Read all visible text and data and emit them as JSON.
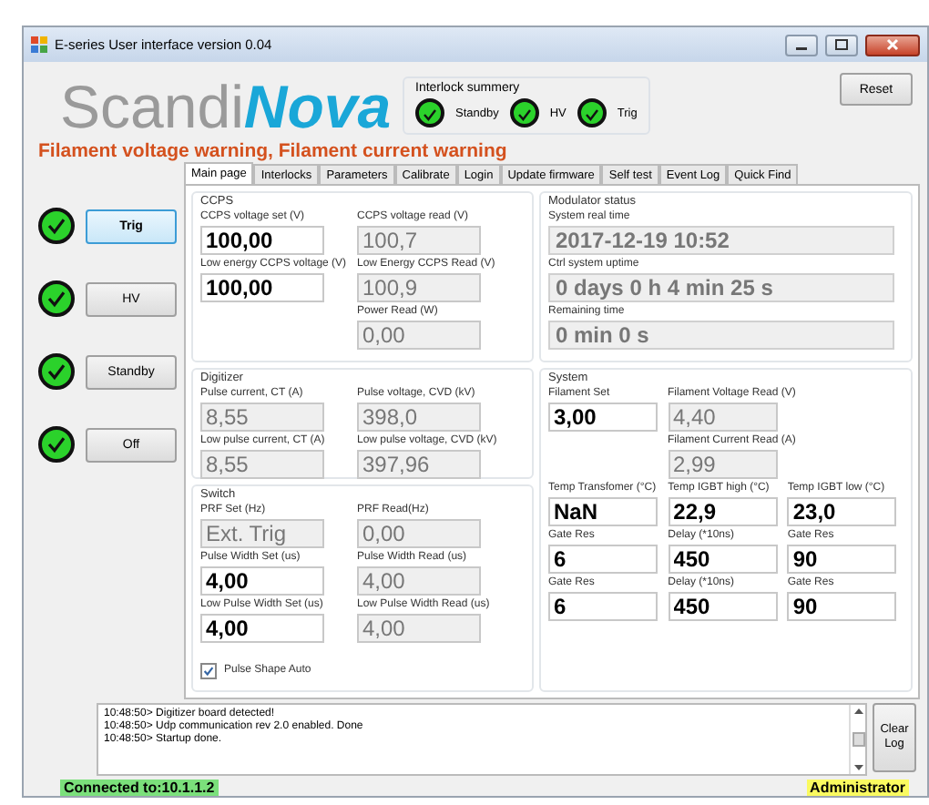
{
  "window": {
    "title": "E-series User interface version 0.04"
  },
  "logo": "Scandi**Nova**",
  "warning": "Filament voltage warning, Filament current warning",
  "interlock_summary": {
    "title": "Interlock summery",
    "items": [
      {
        "label": "Standby",
        "on": true
      },
      {
        "label": "HV",
        "on": true
      },
      {
        "label": "Trig",
        "on": true
      }
    ]
  },
  "reset_button": "Reset",
  "mode_buttons": [
    {
      "label": "Trig",
      "on": true,
      "selected": true
    },
    {
      "label": "HV",
      "on": true,
      "selected": false
    },
    {
      "label": "Standby",
      "on": true,
      "selected": false
    },
    {
      "label": "Off",
      "on": true,
      "selected": false
    }
  ],
  "tabs": [
    {
      "label": "Main page",
      "selected": true
    },
    {
      "label": "Interlocks",
      "selected": false
    },
    {
      "label": "Parameters",
      "selected": false
    },
    {
      "label": "Calibrate",
      "selected": false
    },
    {
      "label": "Login",
      "selected": false
    },
    {
      "label": "Update firmware",
      "selected": false
    },
    {
      "label": "Self test",
      "selected": false
    },
    {
      "label": "Event Log",
      "selected": false
    },
    {
      "label": "Quick Find",
      "selected": false
    }
  ],
  "ccps": {
    "title": "CCPS",
    "rows": [
      {
        "left": {
          "label": "CCPS voltage set (V)",
          "value": "100,00",
          "kind": "input"
        },
        "right": {
          "label": "CCPS voltage read (V)",
          "value": "100,7",
          "kind": "readout"
        }
      },
      {
        "left": {
          "label": "Low energy CCPS voltage (V)",
          "value": "100,00",
          "kind": "input"
        },
        "right": {
          "label": "Low Energy CCPS Read (V)",
          "value": "100,9",
          "kind": "readout"
        }
      },
      {
        "right": {
          "label": "Power Read (W)",
          "value": "0,00",
          "kind": "readout"
        }
      }
    ]
  },
  "digitizer": {
    "title": "Digitizer",
    "rows": [
      {
        "left": {
          "label": "Pulse current, CT (A)",
          "value": "8,55",
          "kind": "readout"
        },
        "right": {
          "label": "Pulse voltage, CVD (kV)",
          "value": "398,0",
          "kind": "readout"
        }
      },
      {
        "left": {
          "label": "Low pulse current, CT (A)",
          "value": "8,55",
          "kind": "readout"
        },
        "right": {
          "label": "Low pulse voltage, CVD (kV)",
          "value": "397,96",
          "kind": "readout"
        }
      }
    ]
  },
  "switch": {
    "title": "Switch",
    "rows": [
      {
        "left": {
          "label": "PRF Set (Hz)",
          "value": "Ext. Trig",
          "kind": "readout"
        },
        "right": {
          "label": "PRF Read(Hz)",
          "value": "0,00",
          "kind": "readout"
        }
      },
      {
        "left": {
          "label": "Pulse Width Set (us)",
          "value": "4,00",
          "kind": "input"
        },
        "right": {
          "label": "Pulse Width Read (us)",
          "value": "4,00",
          "kind": "readout"
        }
      },
      {
        "left": {
          "label": "Low Pulse Width Set (us)",
          "value": "4,00",
          "kind": "input"
        },
        "right": {
          "label": "Low Pulse Width Read (us)",
          "value": "4,00",
          "kind": "readout"
        }
      }
    ],
    "checkbox": {
      "label": "Pulse Shape Auto",
      "checked": true
    }
  },
  "modulator_status": {
    "title": "Modulator status",
    "fields": [
      {
        "label": "System real time",
        "value": "2017-12-19 10:52"
      },
      {
        "label": "Ctrl system uptime",
        "value": "0 days 0 h 4 min 25 s"
      },
      {
        "label": "Remaining time",
        "value": "0 min 0 s"
      }
    ]
  },
  "system": {
    "title": "System",
    "rows": [
      {
        "left": {
          "label": "Filament Set",
          "value": "3,00",
          "kind": "input"
        },
        "middle": {
          "label": "Filament Voltage Read (V)",
          "value": "4,40",
          "kind": "readout"
        }
      },
      {
        "middle": {
          "label": "Filament Current Read (A)",
          "value": "2,99",
          "kind": "readout"
        }
      },
      {
        "left": {
          "label": "Temp Transfomer (°C)",
          "value": "NaN",
          "kind": "input"
        },
        "middle": {
          "label": "Temp IGBT high (°C)",
          "value": "22,9",
          "kind": "input"
        },
        "right": {
          "label": "Temp IGBT low (°C)",
          "value": "23,0",
          "kind": "input"
        }
      },
      {
        "left": {
          "label": "Gate Res",
          "value": "6",
          "kind": "input"
        },
        "middle": {
          "label": "Delay (*10ns)",
          "value": "450",
          "kind": "input"
        },
        "right": {
          "label": "Gate Res",
          "value": "90",
          "kind": "input"
        }
      },
      {
        "left": {
          "label": "Gate Res",
          "value": "6",
          "kind": "input"
        },
        "middle": {
          "label": "Delay (*10ns)",
          "value": "450",
          "kind": "input"
        },
        "right": {
          "label": "Gate Res",
          "value": "90",
          "kind": "input"
        }
      }
    ]
  },
  "log": [
    "10:48:50> Digitizer board detected!",
    "10:48:50> Udp communication rev 2.0 enabled. Done",
    "10:48:50> Startup done."
  ],
  "clear_log_button": "Clear Log",
  "status_bar": {
    "connection": "Connected to:10.1.1.2",
    "user": "Administrator"
  }
}
